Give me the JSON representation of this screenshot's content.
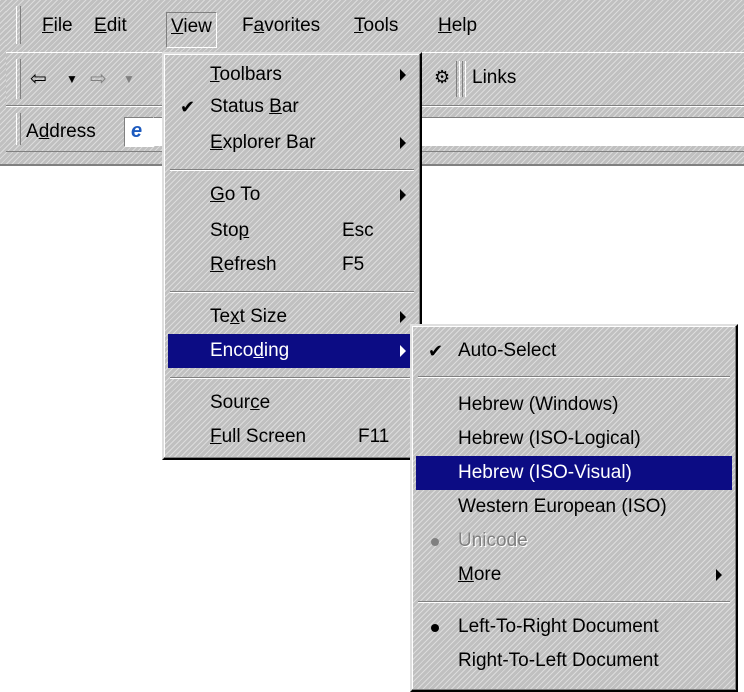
{
  "menubar": {
    "items": [
      {
        "name": "file",
        "before": "",
        "key": "F",
        "after": "ile"
      },
      {
        "name": "edit",
        "before": "",
        "key": "E",
        "after": "dit"
      },
      {
        "name": "view",
        "before": "",
        "key": "V",
        "after": "iew"
      },
      {
        "name": "favorites",
        "before": "F",
        "key": "a",
        "after": "vorites"
      },
      {
        "name": "tools",
        "before": "",
        "key": "T",
        "after": "ools"
      },
      {
        "name": "help",
        "before": "",
        "key": "H",
        "after": "elp"
      }
    ]
  },
  "toolbar": {
    "links_label": "Links"
  },
  "addressbar": {
    "before": "A",
    "key": "d",
    "after": "dress"
  },
  "view_menu": {
    "toolbars": {
      "before": "",
      "key": "T",
      "after": "oolbars"
    },
    "status_bar": {
      "before": "Status ",
      "key": "B",
      "after": "ar"
    },
    "explorer_bar": {
      "before": "",
      "key": "E",
      "after": "xplorer Bar"
    },
    "go_to": {
      "before": "",
      "key": "G",
      "after": "o To"
    },
    "stop": {
      "before": "Sto",
      "key": "p",
      "after": "",
      "shortcut": "Esc"
    },
    "refresh": {
      "before": "",
      "key": "R",
      "after": "efresh",
      "shortcut": "F5"
    },
    "text_size": {
      "before": "Te",
      "key": "x",
      "after": "t Size"
    },
    "encoding": {
      "before": "Enco",
      "key": "d",
      "after": "ing"
    },
    "source": {
      "before": "Sour",
      "key": "c",
      "after": "e"
    },
    "full_screen": {
      "before": "",
      "key": "F",
      "after": "ull Screen",
      "shortcut": "F11"
    }
  },
  "encoding_menu": {
    "auto_select": "Auto-Select",
    "hebrew_windows": "Hebrew (Windows)",
    "hebrew_iso_logical": "Hebrew (ISO-Logical)",
    "hebrew_iso_visual": "Hebrew (ISO-Visual)",
    "western_european": "Western European (ISO)",
    "unicode": "Unicode",
    "more": {
      "before": "",
      "key": "M",
      "after": "ore"
    },
    "ltr_document": "Left-To-Right Document",
    "rtl_document": "Right-To-Left Document"
  },
  "colors": {
    "highlight": "#0c0c84",
    "face": "#c0c0c0"
  }
}
